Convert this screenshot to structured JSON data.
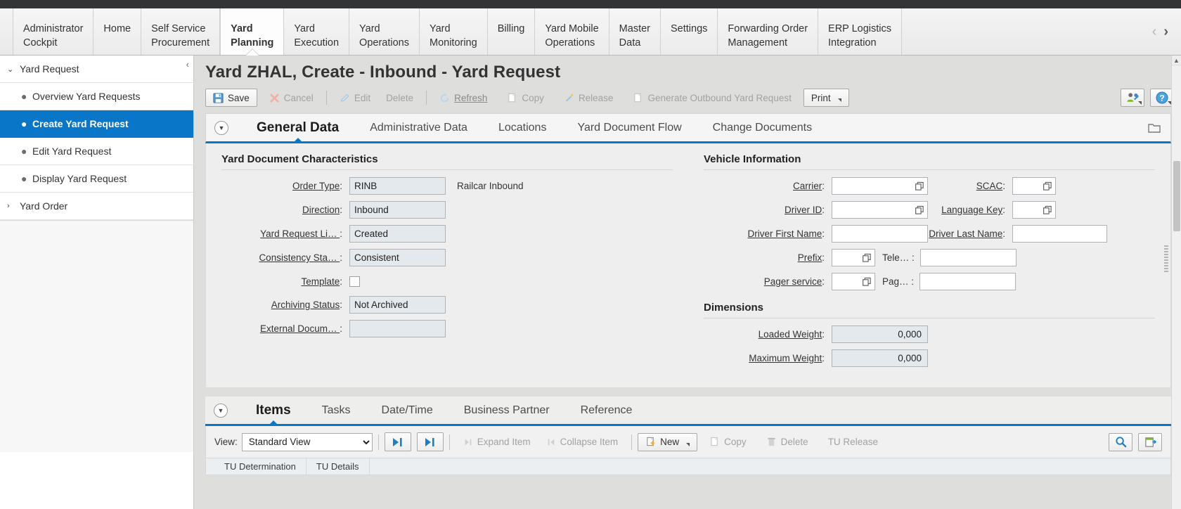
{
  "topnav": {
    "items": [
      {
        "label": "Administrator\nCockpit",
        "active": false
      },
      {
        "label": "Home",
        "active": false
      },
      {
        "label": "Self Service\nProcurement",
        "active": false
      },
      {
        "label": "Yard\nPlanning",
        "active": true
      },
      {
        "label": "Yard\nExecution",
        "active": false
      },
      {
        "label": "Yard\nOperations",
        "active": false
      },
      {
        "label": "Yard\nMonitoring",
        "active": false
      },
      {
        "label": "Billing",
        "active": false
      },
      {
        "label": "Yard Mobile\nOperations",
        "active": false
      },
      {
        "label": "Master\nData",
        "active": false
      },
      {
        "label": "Settings",
        "active": false
      },
      {
        "label": "Forwarding Order\nManagement",
        "active": false
      },
      {
        "label": "ERP Logistics\nIntegration",
        "active": false
      }
    ],
    "prev_arrow": "‹",
    "next_arrow": "›"
  },
  "sidenav": {
    "collapse_glyph": "‹",
    "groups": [
      {
        "label": "Yard Request",
        "twisty": "⌄",
        "expanded": true,
        "items": [
          {
            "label": "Overview Yard Requests",
            "selected": false
          },
          {
            "label": "Create Yard Request",
            "selected": true
          },
          {
            "label": "Edit Yard Request",
            "selected": false
          },
          {
            "label": "Display Yard Request",
            "selected": false
          }
        ]
      },
      {
        "label": "Yard Order",
        "twisty": "›",
        "expanded": false,
        "items": []
      }
    ]
  },
  "header": {
    "title": "Yard ZHAL,  Create - Inbound - Yard Request"
  },
  "toolbar": {
    "save_label": "Save",
    "cancel_label": "Cancel",
    "edit_label": "Edit",
    "delete_label": "Delete",
    "refresh_label": "Refresh",
    "copy_label": "Copy",
    "release_label": "Release",
    "generate_label": "Generate Outbound Yard Request",
    "print_label": "Print",
    "personalize_name": "personalize-icon",
    "help_name": "help-icon"
  },
  "main_tabs": {
    "collapse_glyph": "▼",
    "tabs": [
      {
        "label": "General Data",
        "active": true
      },
      {
        "label": "Administrative Data",
        "active": false
      },
      {
        "label": "Locations",
        "active": false
      },
      {
        "label": "Yard Document Flow",
        "active": false
      },
      {
        "label": "Change Documents",
        "active": false
      }
    ]
  },
  "form": {
    "left_group_title": "Yard Document Characteristics",
    "left_fields": [
      {
        "label": "Order Type",
        "underline": true,
        "value": "RINB",
        "suffix": "Railcar Inbound",
        "type": "input"
      },
      {
        "label": "Direction",
        "underline": true,
        "value": "Inbound",
        "suffix": "",
        "type": "input"
      },
      {
        "label": "Yard Request Li… ",
        "underline": true,
        "value": "Created",
        "suffix": "",
        "type": "input"
      },
      {
        "label": "Consistency Sta… ",
        "underline": true,
        "value": "Consistent",
        "suffix": "",
        "type": "input"
      },
      {
        "label": "Template",
        "underline": true,
        "value": "",
        "suffix": "",
        "type": "checkbox"
      },
      {
        "label": "Archiving Status",
        "underline": true,
        "value": "Not Archived",
        "suffix": "",
        "type": "input"
      },
      {
        "label": "External Docum… ",
        "underline": true,
        "value": "",
        "suffix": "",
        "type": "input"
      }
    ],
    "right_group_title": "Vehicle Information",
    "right_fields": [
      {
        "label": "Carrier",
        "value": "",
        "valuehelp": true,
        "second_label": "SCAC",
        "second_value": "",
        "second_valuehelp": true,
        "second_width": "small"
      },
      {
        "label": "Driver ID",
        "value": "",
        "valuehelp": true,
        "second_label": "Language Key",
        "second_value": "",
        "second_valuehelp": true,
        "second_width": "small"
      },
      {
        "label": "Driver First Name",
        "value": "",
        "valuehelp": false,
        "second_label": "Driver Last Name",
        "second_value": "",
        "second_valuehelp": false,
        "second_width": "wide"
      },
      {
        "label": "Prefix",
        "value": "",
        "valuehelp": true,
        "width": "small",
        "second_label": "Tele… ",
        "second_value": "",
        "second_valuehelp": false,
        "second_width": "wide"
      },
      {
        "label": "Pager service",
        "value": "",
        "valuehelp": true,
        "width": "small",
        "second_label": "Pag… ",
        "second_value": "",
        "second_valuehelp": false,
        "second_width": "wide"
      }
    ],
    "dimensions_title": "Dimensions",
    "dimension_fields": [
      {
        "label": "Loaded Weight",
        "value": "0,000"
      },
      {
        "label": "Maximum Weight",
        "value": "0,000"
      }
    ]
  },
  "items_section": {
    "collapse_glyph": "▼",
    "tabs": [
      {
        "label": "Items",
        "active": true
      },
      {
        "label": "Tasks",
        "active": false
      },
      {
        "label": "Date/Time",
        "active": false
      },
      {
        "label": "Business Partner",
        "active": false
      },
      {
        "label": "Reference",
        "active": false
      }
    ],
    "toolbar": {
      "view_label": "View:",
      "view_value": "Standard View",
      "view_options": [
        "Standard View"
      ],
      "expand_item_label": "Expand Item",
      "collapse_item_label": "Collapse Item",
      "new_label": "New",
      "copy_label": "Copy",
      "delete_label": "Delete",
      "tu_release_label": "TU Release",
      "search_icon": "search-icon",
      "export_icon": "export-icon"
    },
    "grid_headers": [
      "TU Determination",
      "TU Details"
    ]
  },
  "colors": {
    "accent": "#0a76c8",
    "selected_nav": "#0a76c8",
    "page_bg": "#dededd",
    "form_bg": "#eeeeee",
    "input_bg": "#e4e9ee",
    "topbar": "#333436"
  }
}
